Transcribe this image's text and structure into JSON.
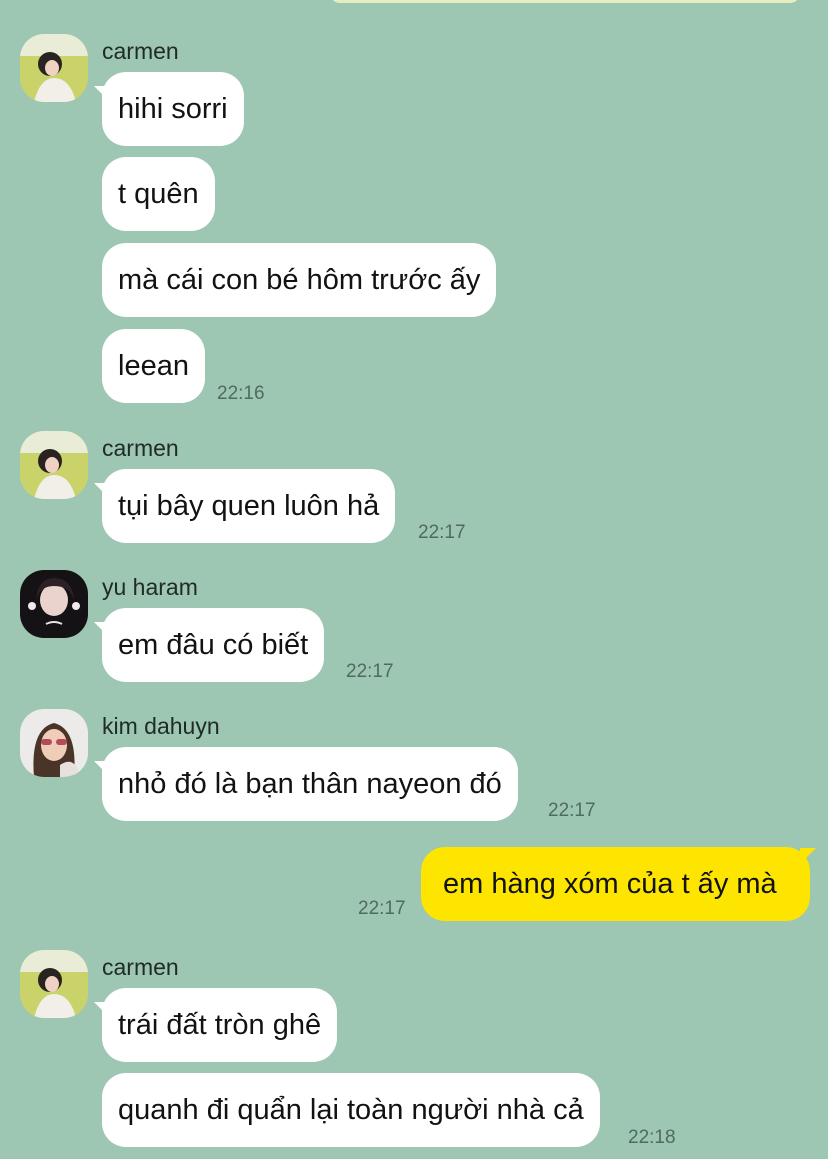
{
  "messages": [
    {
      "sender": "carmen",
      "lines": [
        "hihi sorri",
        "t quên",
        "mà cái con bé hôm trước ấy",
        "leean"
      ],
      "time": "22:16"
    },
    {
      "sender": "carmen",
      "lines": [
        "tụi bây quen luôn hả"
      ],
      "time": "22:17"
    },
    {
      "sender": "yu haram",
      "lines": [
        "em đâu có biết"
      ],
      "time": "22:17"
    },
    {
      "sender": "kim dahuyn",
      "lines": [
        "nhỏ đó là bạn thân nayeon đó"
      ],
      "time": "22:17"
    },
    {
      "sender": "me",
      "lines": [
        "em hàng xóm của t ấy mà"
      ],
      "time": "22:17"
    },
    {
      "sender": "carmen",
      "lines": [
        "trái đất tròn ghê",
        "quanh đi quẩn lại toàn người nhà cả"
      ],
      "time": "22:18"
    }
  ],
  "colors": {
    "background": "#9dc6b3",
    "incoming_bubble": "#ffffff",
    "outgoing_bubble": "#fee500"
  },
  "icons": {
    "avatar_carmen": "profile-photo",
    "avatar_yu_haram": "profile-photo",
    "avatar_kim_dahuyn": "profile-photo"
  }
}
